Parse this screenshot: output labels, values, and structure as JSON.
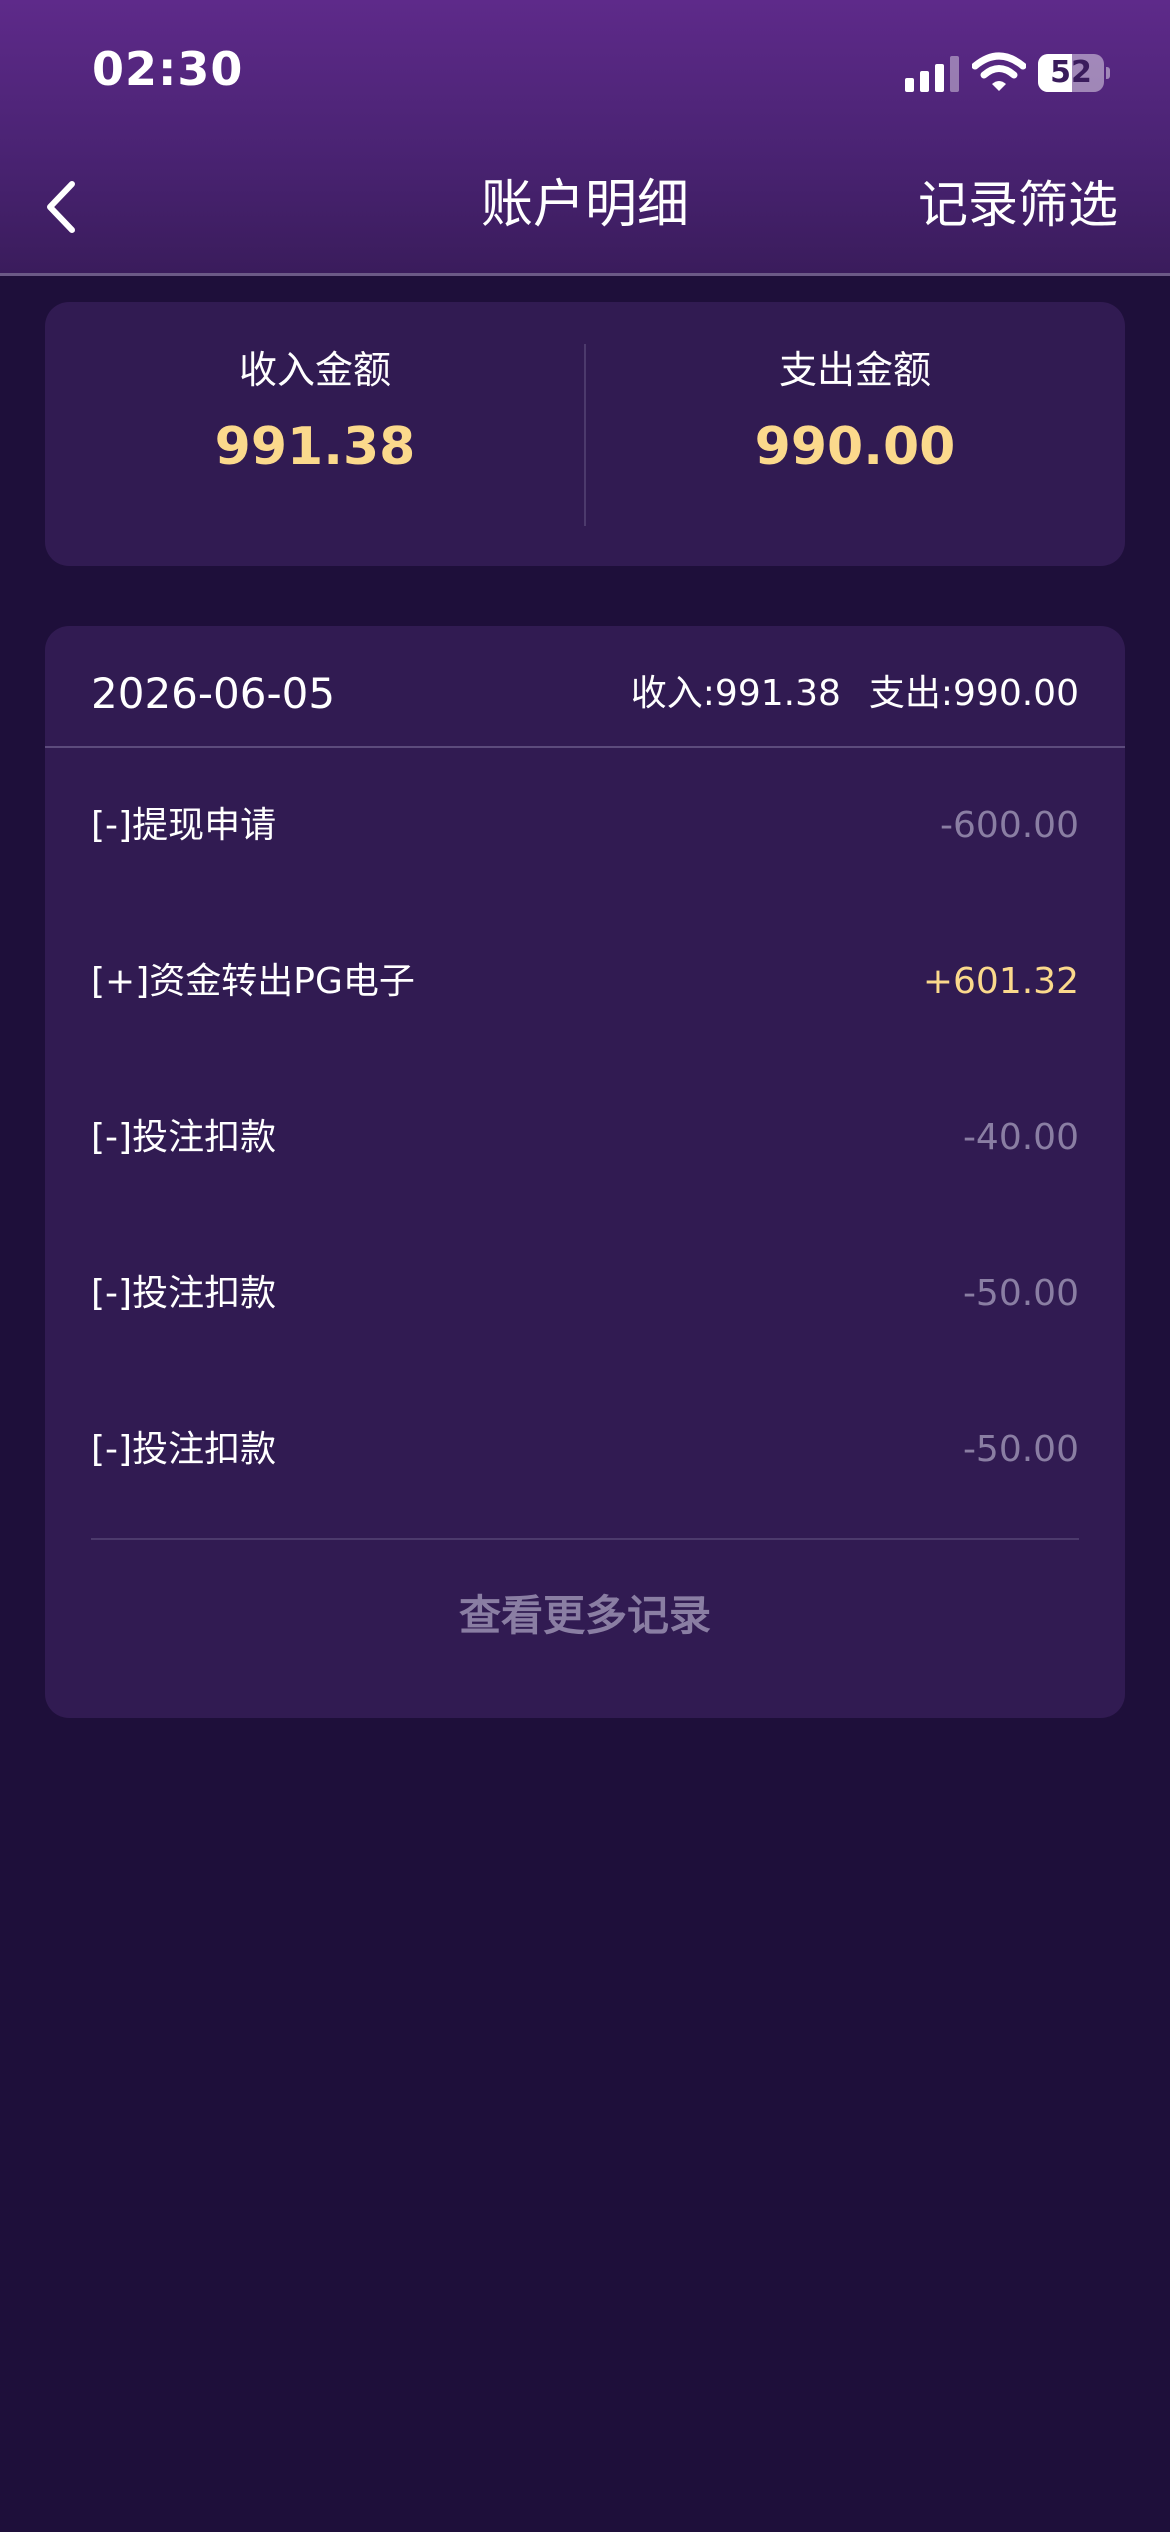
{
  "status_bar": {
    "time": "02:30",
    "battery": "52",
    "battery_level_percent": 52,
    "icons": [
      "cellular-signal-icon",
      "wifi-icon",
      "battery-icon"
    ]
  },
  "nav": {
    "back_icon": "chevron-left-icon",
    "title": "账户明细",
    "filter_label": "记录筛选"
  },
  "summary": {
    "income_label": "收入金额",
    "income_value": "991.38",
    "expense_label": "支出金额",
    "expense_value": "990.00"
  },
  "records": {
    "date": "2026-06-05",
    "income_sum": "收入:991.38",
    "expense_sum": "支出:990.00",
    "items": [
      {
        "name": "[-]提现申请",
        "amount": "-600.00"
      },
      {
        "name": "[+]资金转出PG电子",
        "amount": "+601.32"
      },
      {
        "name": "[-]投注扣款",
        "amount": "-40.00"
      },
      {
        "name": "[-]投注扣款",
        "amount": "-50.00"
      },
      {
        "name": "[-]投注扣款",
        "amount": "-50.00"
      }
    ],
    "more_label": "查看更多记录"
  },
  "colors": {
    "background": "#1e0f3a",
    "card": "#311b52",
    "header_top": "#5e2a8a",
    "accent_gold": "#fbd98c",
    "muted_text": "#8a7ea3"
  }
}
